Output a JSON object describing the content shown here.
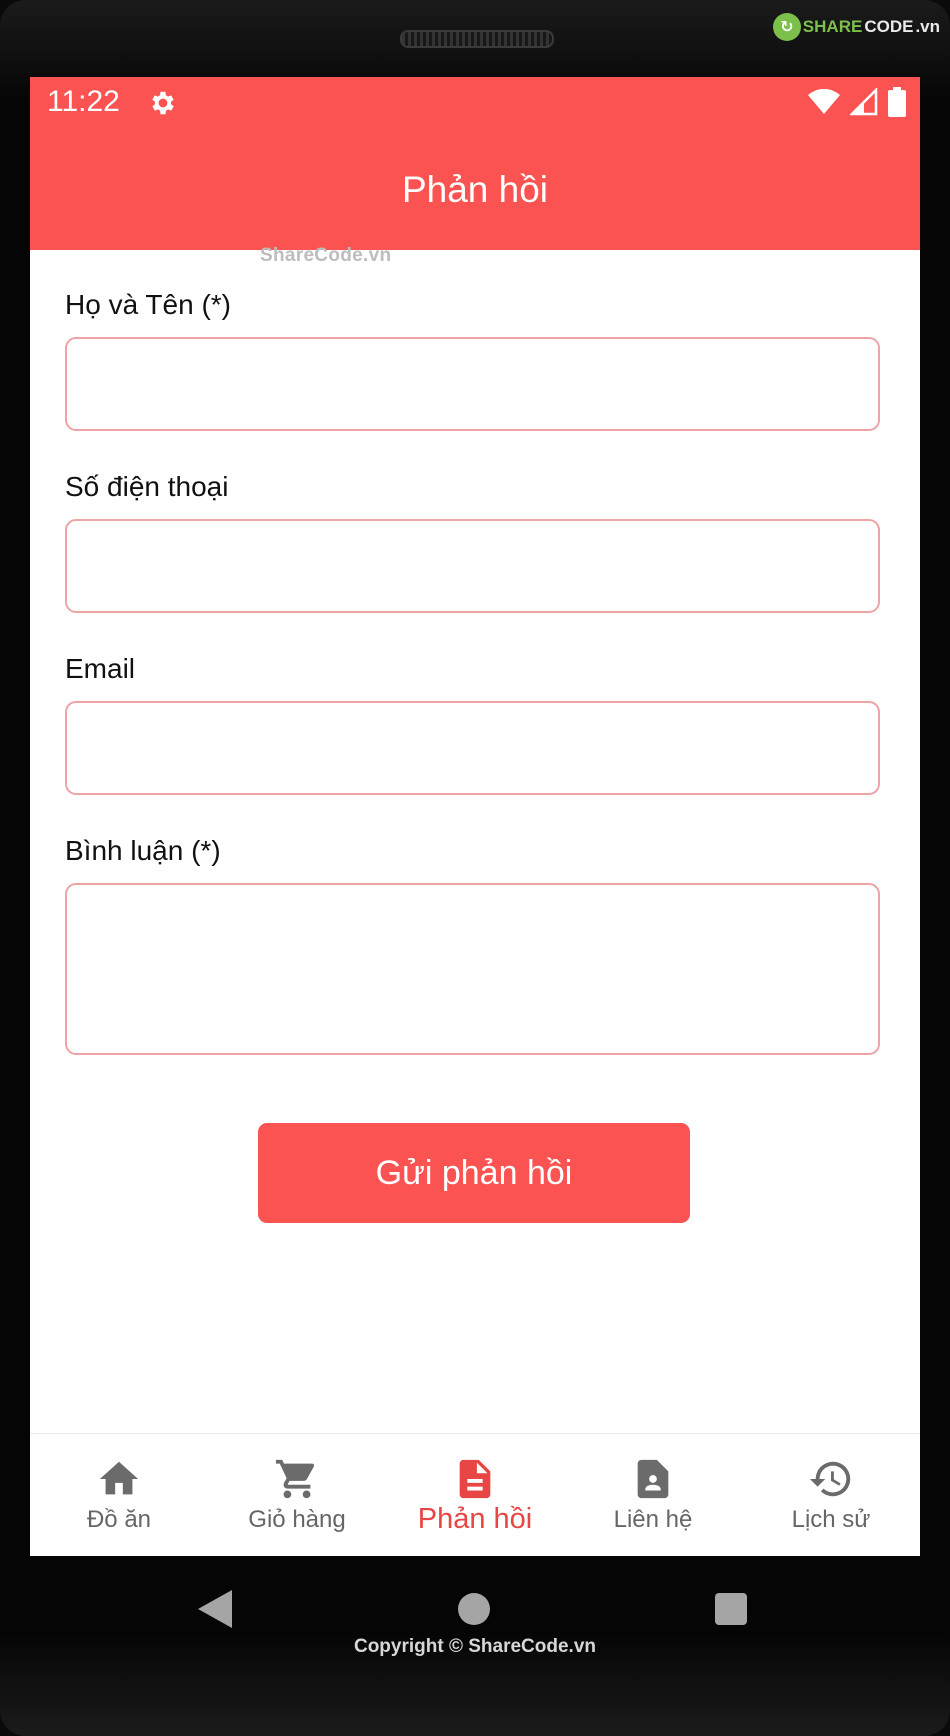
{
  "status_bar": {
    "time": "11:22"
  },
  "watermark": {
    "logo_share": "SHARE",
    "logo_code": "CODE",
    "logo_vn": ".vn",
    "mini": "ShareCode.vn",
    "copyright": "Copyright © ShareCode.vn"
  },
  "header": {
    "title": "Phản hồi"
  },
  "form": {
    "name_label": "Họ và Tên (*)",
    "phone_label": "Số điện thoại",
    "email_label": "Email",
    "comment_label": "Bình luận (*)",
    "name_value": "",
    "phone_value": "",
    "email_value": "",
    "comment_value": "",
    "submit_label": "Gửi phản hồi"
  },
  "bottom_nav": {
    "active": "Phản hồi",
    "items": [
      {
        "label": "Đồ ăn",
        "icon": "home-icon"
      },
      {
        "label": "Giỏ hàng",
        "icon": "cart-icon"
      },
      {
        "label": "Phản hồi",
        "icon": "document-icon"
      },
      {
        "label": "Liên hệ",
        "icon": "contact-icon"
      },
      {
        "label": "Lịch sử",
        "icon": "history-icon"
      }
    ]
  },
  "colors": {
    "primary": "#fb5352",
    "active_nav": "#e84545",
    "input_border": "#eea4a4"
  }
}
